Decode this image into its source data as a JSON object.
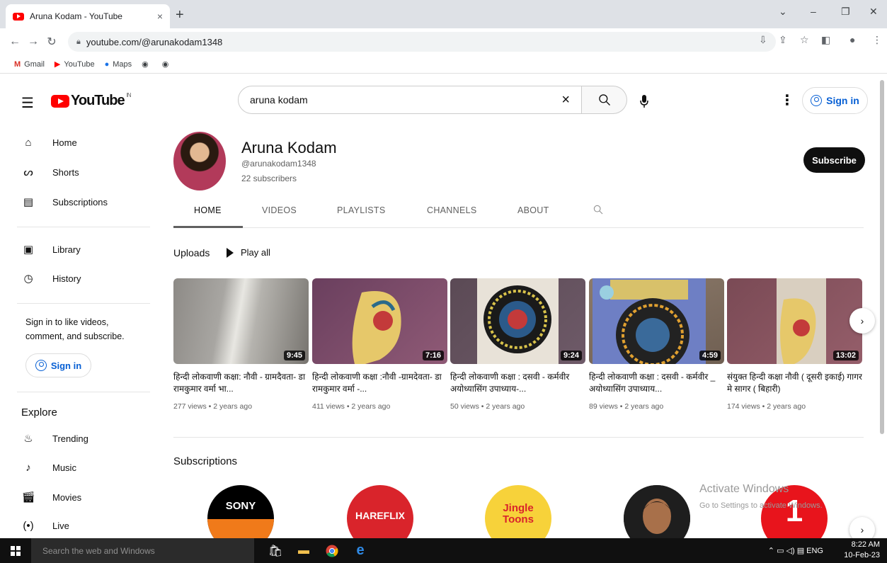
{
  "browser": {
    "tab_title": "Aruna Kodam - YouTube",
    "tab_close": "×",
    "new_tab": "+",
    "url": "youtube.com/@arunakodam1348",
    "bookmarks": [
      "Gmail",
      "YouTube",
      "Maps"
    ]
  },
  "header": {
    "logo_text": "YouTube",
    "logo_region": "IN",
    "search_value": "aruna kodam",
    "clear_symbol": "×",
    "sign_in_label": "Sign in"
  },
  "sidebar": {
    "items": [
      {
        "label": "Home",
        "icon": "home-icon"
      },
      {
        "label": "Shorts",
        "icon": "shorts-icon"
      },
      {
        "label": "Subscriptions",
        "icon": "subscriptions-icon"
      },
      {
        "label": "Library",
        "icon": "library-icon"
      },
      {
        "label": "History",
        "icon": "history-icon"
      }
    ],
    "signin_message": "Sign in to like videos, comment, and subscribe.",
    "signin_label": "Sign in",
    "explore_title": "Explore",
    "explore_items": [
      {
        "label": "Trending",
        "icon": "trending-icon"
      },
      {
        "label": "Music",
        "icon": "music-icon"
      },
      {
        "label": "Movies",
        "icon": "movies-icon"
      },
      {
        "label": "Live",
        "icon": "live-icon"
      }
    ]
  },
  "channel": {
    "name": "Aruna Kodam",
    "handle": "@arunakodam1348",
    "subscribers": "22 subscribers",
    "subscribe_label": "Subscribe",
    "tabs": [
      "HOME",
      "VIDEOS",
      "PLAYLISTS",
      "CHANNELS",
      "ABOUT"
    ],
    "active_tab": "HOME"
  },
  "uploads": {
    "title": "Uploads",
    "play_all": "Play all",
    "videos": [
      {
        "title": "हिन्दी लोकवाणी कक्षा: नौवी - ग्रामदैवता- डा रामकुमार वर्मा भा...",
        "duration": "9:45",
        "meta": "277 views • 2 years ago"
      },
      {
        "title": "हिन्दी लोकवाणी कक्षा :नौवी -ग्रामदेवता- डा रामकुमार वर्मा -...",
        "duration": "7:16",
        "meta": "411 views • 2 years ago"
      },
      {
        "title": "हिन्दी लोकवाणी कक्षा : दसवी - कर्मवीर अयोध्यासिंग उपाध्याय-...",
        "duration": "9:24",
        "meta": "50 views • 2 years ago"
      },
      {
        "title": "हिन्दी लोकवाणी कक्षा : दसवी - कर्मवीर _ अयोध्यासिंग उपाध्याय...",
        "duration": "4:59",
        "meta": "89 views • 2 years ago"
      },
      {
        "title": "संयुक्त हिन्दी कक्षा नौवी ( दूसरी इकाई) गागर मे सागर ( बिहारी)",
        "duration": "13:02",
        "meta": "174 views • 2 years ago"
      }
    ]
  },
  "subscriptions": {
    "title": "Subscriptions",
    "channels": [
      {
        "label": "SONY",
        "bg": "#000000"
      },
      {
        "label": "HAREFLIX",
        "bg": "#d9242b"
      },
      {
        "label": "Jingle Toons",
        "bg": "#f7d23a"
      },
      {
        "label": "",
        "bg": "#2a2a2a"
      },
      {
        "label": "1",
        "bg": "#e8141c"
      }
    ]
  },
  "watermark": {
    "line1": "Activate Windows",
    "line2": "Go to Settings to activate Windows."
  },
  "taskbar": {
    "search_placeholder": "Search the web and Windows",
    "tray": "ENG",
    "time": "8:22 AM",
    "date": "10-Feb-23"
  },
  "colors": {
    "yt_red": "#ff0000",
    "link_blue": "#065fd4",
    "subscribe_bg": "#0f0f0f"
  }
}
